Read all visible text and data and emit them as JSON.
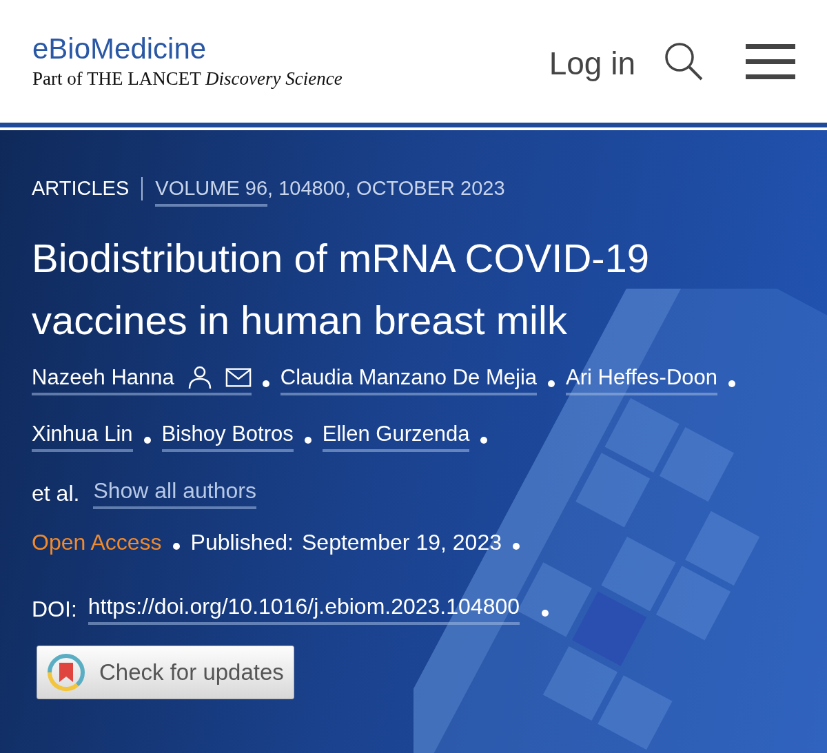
{
  "header": {
    "journal": "eBioMedicine",
    "subtitle": "Part of THE LANCET *Discovery Science*",
    "login": "Log in"
  },
  "article": {
    "type": "ARTICLES",
    "citation_link": "VOLUME 96",
    "citation_rest": ", 104800, OCTOBER 2023",
    "title": "Biodistribution of mRNA COVID-19 vaccines in human breast milk",
    "authors": [
      {
        "name": "Nazeeh Hanna",
        "corresponding": true
      },
      {
        "name": "Claudia Manzano De Mejia",
        "corresponding": false
      },
      {
        "name": "Ari Heffes-Doon",
        "corresponding": false
      },
      {
        "name": "Xinhua Lin",
        "corresponding": false
      },
      {
        "name": "Bishoy Botros",
        "corresponding": false
      },
      {
        "name": "Ellen Gurzenda",
        "corresponding": false
      }
    ],
    "et_al": "et al.",
    "show_all": "Show all authors",
    "access": "Open Access",
    "published_label": "Published:",
    "published_date": "September 19, 2023",
    "doi_label": "DOI:",
    "doi": "https://doi.org/10.1016/j.ebiom.2023.104800",
    "updates_button": "Check for updates"
  }
}
